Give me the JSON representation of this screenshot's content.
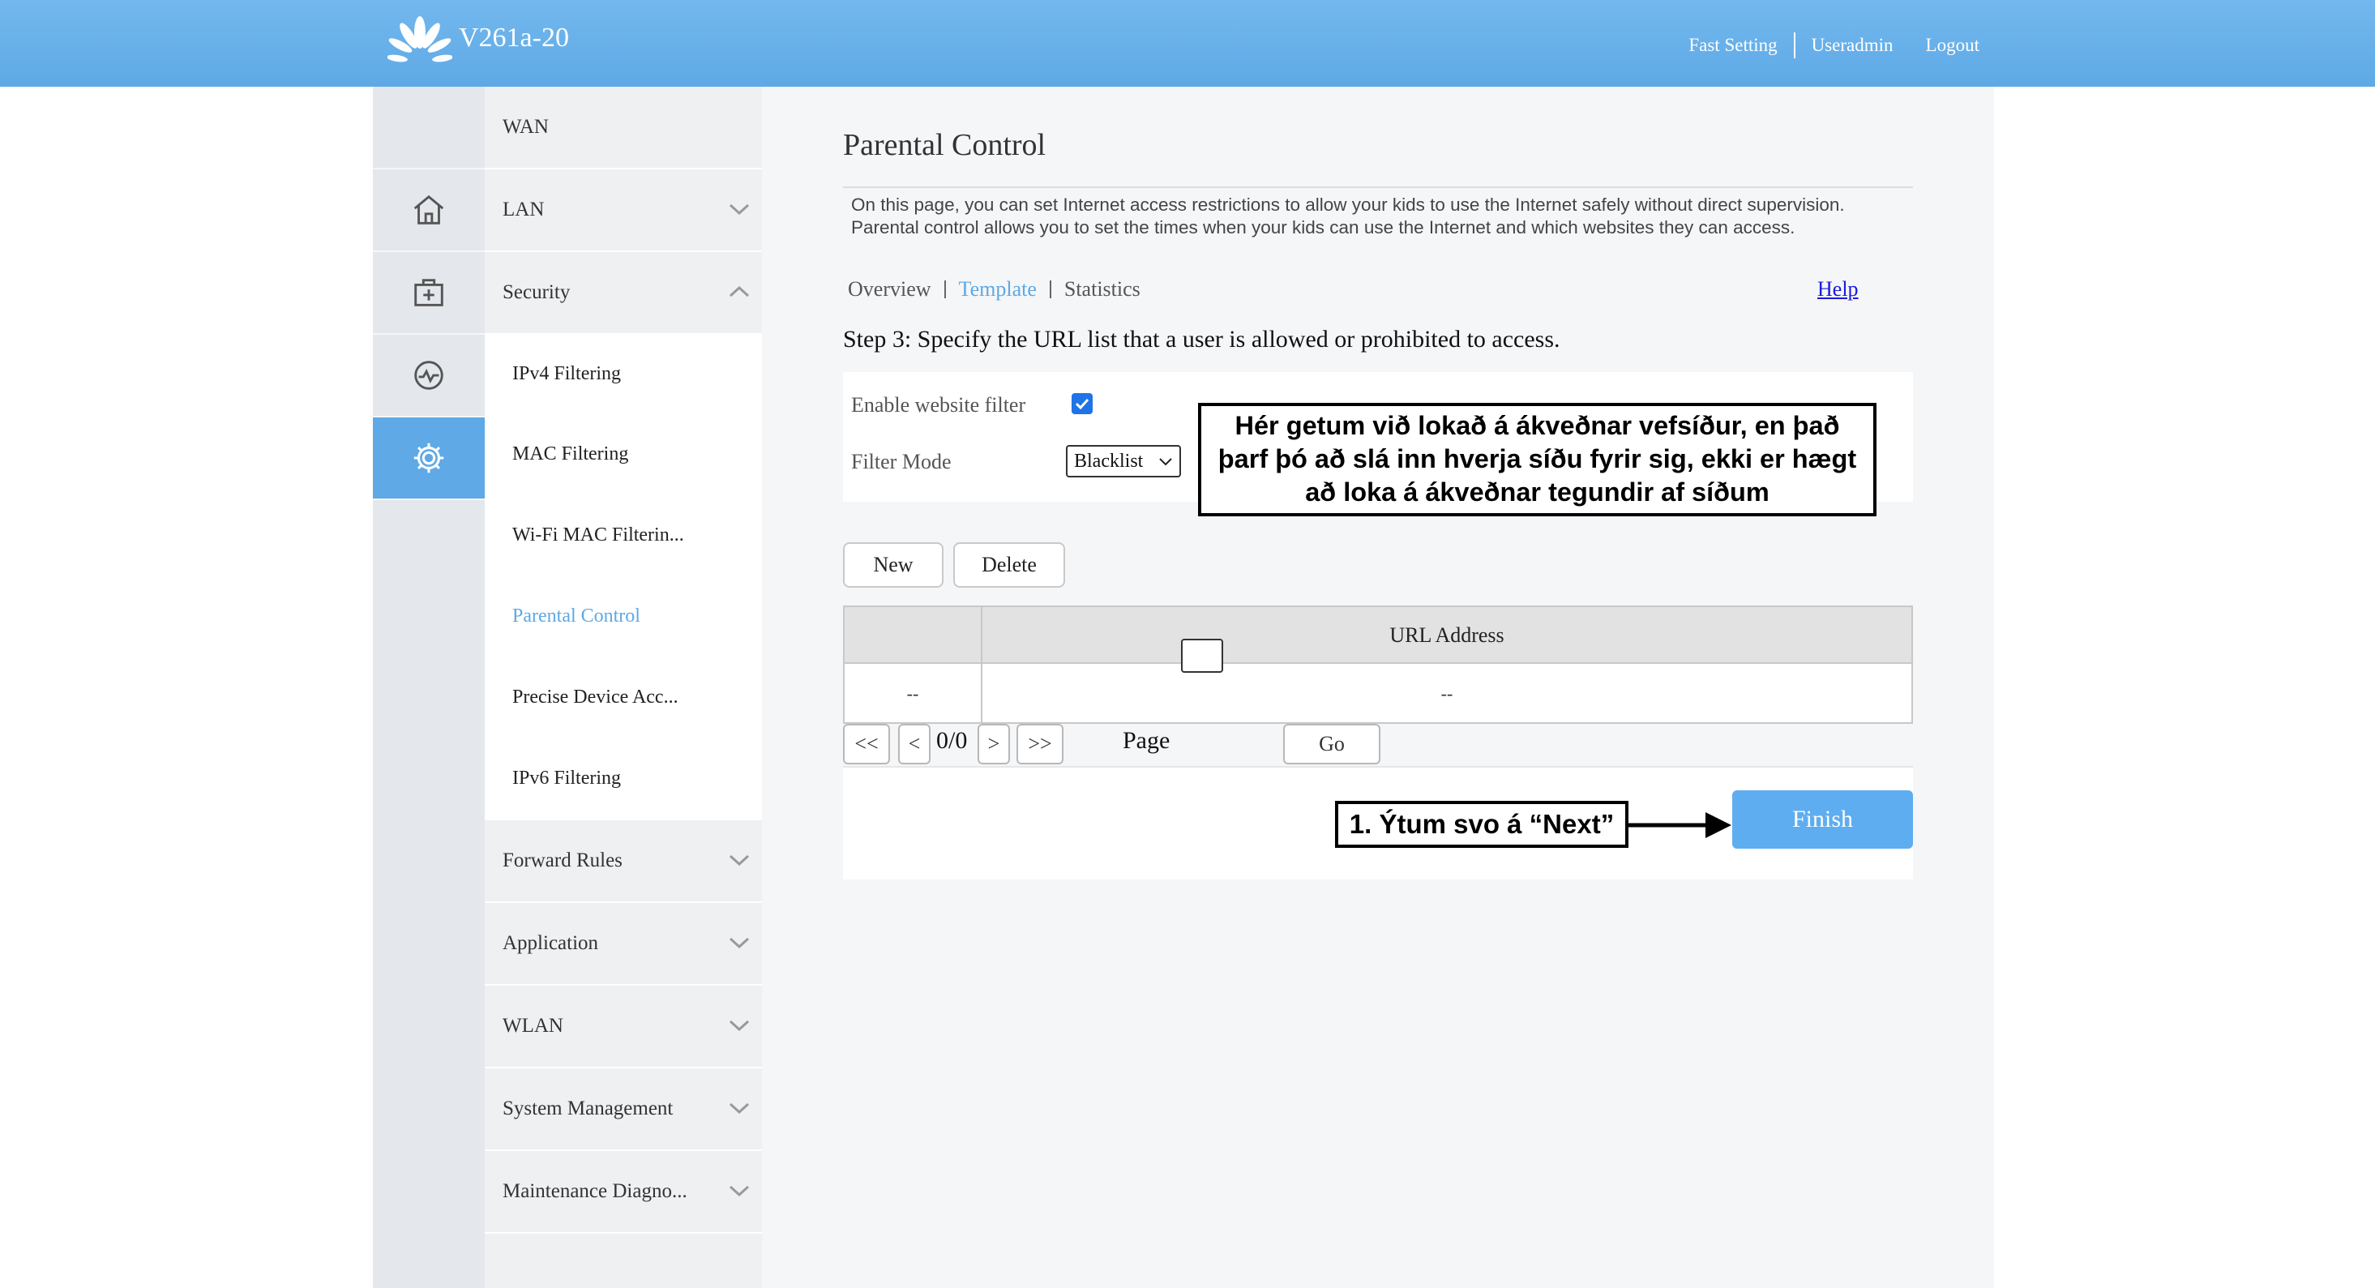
{
  "header": {
    "model": "V261a-20",
    "links": [
      "Fast Setting",
      "Useradmin",
      "Logout"
    ],
    "bg_color": "#5ea9e6"
  },
  "rail": {
    "icons": [
      "home-icon",
      "toolbox-icon",
      "monitor-icon",
      "gear-icon"
    ],
    "active": "gear-icon"
  },
  "menu": {
    "wan": "WAN",
    "lan": "LAN",
    "security": "Security",
    "forward_rules": "Forward Rules",
    "application": "Application",
    "wlan": "WLAN",
    "system_management": "System Management",
    "maintenance": "Maintenance Diagno...",
    "security_items": [
      "IPv4 Filtering",
      "MAC Filtering",
      "Wi-Fi MAC Filterin...",
      "Parental Control",
      "Precise Device Acc...",
      "IPv6 Filtering"
    ],
    "active_item": "Parental Control"
  },
  "content": {
    "title": "Parental Control",
    "desc_line1": "On this page, you can set Internet access restrictions to allow your kids to use the Internet safely without direct supervision.",
    "desc_line2": "Parental control allows you to set the times when your kids can use the Internet and which websites they can access.",
    "tabs": [
      "Overview",
      "Template",
      "Statistics"
    ],
    "active_tab": "Template",
    "help": "Help",
    "step": "Step 3: Specify the URL list that a user is allowed or prohibited to access.",
    "enable_label": "Enable website filter",
    "enable_checked": true,
    "filter_mode_label": "Filter Mode",
    "filter_mode_value": "Blacklist",
    "buttons": {
      "new": "New",
      "delete": "Delete"
    },
    "table": {
      "header": "URL Address",
      "row": [
        "--",
        "--"
      ]
    },
    "pagination": {
      "first": "<<",
      "prev": "<",
      "count": "0/0",
      "next": ">",
      "last": ">>",
      "page_label": "Page",
      "go": "Go"
    },
    "finish": "Finish",
    "accent_color": "#5ea9e6"
  },
  "annotations": {
    "callout_top_line1": "Hér getum við lokað á ákveðnar vefsíður, en það",
    "callout_top_line2": "þarf þó að slá inn hverja síðu fyrir sig, ekki er hægt",
    "callout_top_line3": "að loka á ákveðnar tegundir af síðum",
    "callout_bottom": "1. Ýtum svo á “Next”"
  }
}
